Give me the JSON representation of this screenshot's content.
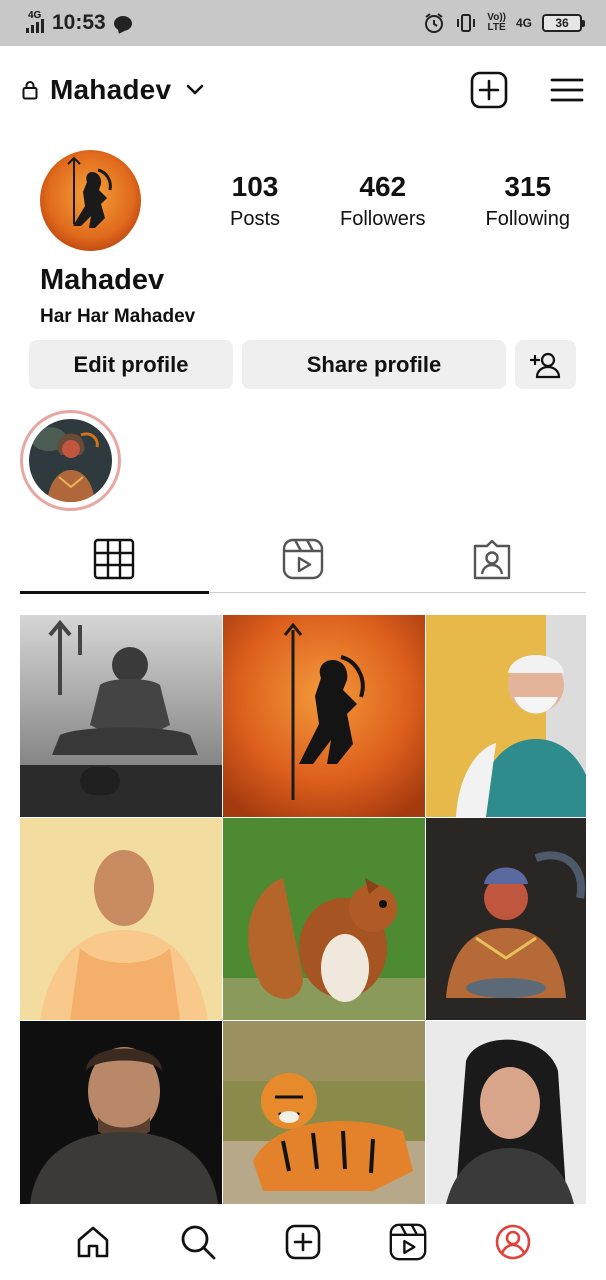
{
  "status_bar": {
    "network": "4G",
    "time": "10:53",
    "volte_top": "Vo))",
    "volte_bottom": "LTE",
    "network2": "4G",
    "battery": "36"
  },
  "header": {
    "username": "Mahadev",
    "icons": [
      "lock-icon",
      "chevron-down-icon",
      "create-post-icon",
      "menu-icon"
    ]
  },
  "profile": {
    "display_name": "Mahadev",
    "bio": "Har Har Mahadev",
    "stats": [
      {
        "value": "103",
        "label": "Posts"
      },
      {
        "value": "462",
        "label": "Followers"
      },
      {
        "value": "315",
        "label": "Following"
      }
    ]
  },
  "actions": {
    "edit_label": "Edit profile",
    "share_label": "Share profile"
  },
  "tabs": [
    "grid-icon",
    "reels-icon",
    "tagged-icon"
  ],
  "posts": [
    "shiva-statue",
    "shiva-silhouette",
    "man-portrait-white-beard",
    "man-saffron-robe",
    "squirrel",
    "hanuman-art",
    "man-portrait-dark",
    "tiger",
    "woman-selfie"
  ],
  "bottom_nav": [
    "home-icon",
    "search-icon",
    "create-icon",
    "reels-icon",
    "profile-icon"
  ],
  "colors": {
    "accent": "#e0433b",
    "button_bg": "#efefef",
    "status_bar_bg": "#c8c8c8"
  }
}
